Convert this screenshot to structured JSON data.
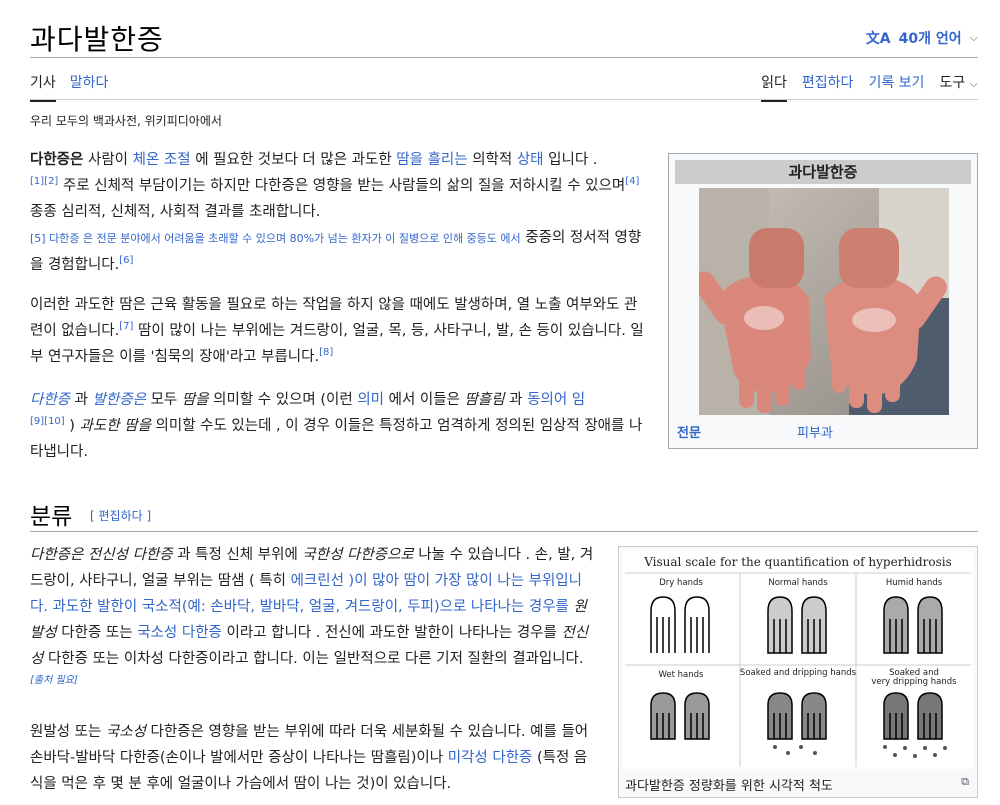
{
  "page": {
    "title": "과다발한증",
    "languages": "40개 언어",
    "tagline": "우리 모두의 백과사전, 위키피디아에서"
  },
  "tabs_left": [
    "기사",
    "말하다"
  ],
  "tabs_right": [
    "읽다",
    "편집하다",
    "기록 보기",
    "도구"
  ],
  "infobox": {
    "title": "과다발한증",
    "row_label": "전문",
    "row_value": "피부과"
  },
  "section": {
    "heading": "분류",
    "edit": "[ 편집하다 ]"
  },
  "figure": {
    "chart_title": "Visual scale for the quantification of hyperhidrosis",
    "panels": [
      "Dry hands",
      "Normal hands",
      "Humid hands",
      "Wet hands",
      "Soaked and dripping hands",
      "Soaked and very dripping hands"
    ],
    "caption": "과다발한증 정량화를 위한 시각적 척도"
  },
  "text": {
    "p1_a": "다한증은",
    "p1_b": " 사람이 ",
    "p1_link1": "체온 조절",
    "p1_c": " 에 필요한 것보다 더 많은 과도한 ",
    "p1_link2": "땀을 흘리는",
    "p1_d": " 의학적 ",
    "p1_link3": "상태",
    "p1_e": " 입니다 .",
    "p1_ref1": "[1][2]",
    "p1_f": " 주로 신체적 부담이기는 하지만 다한증은 영향을 받는 사람들의 삶의 질을 저하시킬 수 있으며",
    "p1_ref2": "[4]",
    "p1_g": " 종종 심리적, 신체적, 사회적 결과를 초래합니다.",
    "p1_small": "[5] 다한증 은 전문 분야에서 어려움을 초래할 수 있으며 80%가 넘는 환자가 이 질병으로 인해 중등도 에서",
    "p1_h": " 중증의 정서적 영향을 경험합니다.",
    "p1_ref3": "[6]",
    "p2_a": "이러한 과도한 땀은 근육 활동을 필요로 하는 작업을 하지 않을 때에도 발생하며, 열 노출 여부와도 관련이 없습니다.",
    "p2_ref1": "[7]",
    "p2_b": " 땀이 많이 나는 부위에는 겨드랑이, 얼굴, 목, 등, 사타구니, 발, 손 등이 있습니다. 일부 연구자들은 이를 '침묵의 장애'라고 부릅니다.",
    "p2_ref2": "[8]",
    "p3_link1": "다한증",
    "p3_a": " 과 ",
    "p3_link2": "발한증은",
    "p3_b": " 모두 ",
    "p3_c": "땀을",
    "p3_d": " 의미할 수 있으며 (이런 ",
    "p3_link3": "의미",
    "p3_e": " 에서 이들은 ",
    "p3_f": "땀흘림",
    "p3_g": " 과 ",
    "p3_link4": "동의어 임",
    "p3_ref": "[9][10]",
    "p3_h": " ) ",
    "p3_i": "과도한 땀을",
    "p3_j": " 의미할 수도 있는데 , 이 경우 이들은 특정하고 엄격하게 정의된 임상적 장애를 나타냅니다.",
    "p4_a": "다한증은 전신성 다한증",
    "p4_b": " 과 특정 신체 부위에 ",
    "p4_c": "국한성 다한증으로",
    "p4_d": " 나눌 수 있습니다 . 손, 발, 겨드랑이, 사타구니, 얼굴 부위는 땀샘 ( 특히 ",
    "p4_link1": "에크린선 )이 많아 땀이 가장 많이 나는 부위입니다. 과도한 발한이 국소적(예: 손바닥, 발바닥, 얼굴, 겨드랑이, 두피)으로 나타나는 경우를",
    "p4_e": " 원발성",
    "p4_f": " 다한증 또는 ",
    "p4_link2": "국소성 다한증",
    "p4_g": " 이라고 합니다 . 전신에 과도한 발한이 나타나는 경우를 ",
    "p4_h": "전신성",
    "p4_i": " 다한증 또는 이차성 다한증이라고 합니다. 이는 일반적으로 다른 기저 질환의 결과입니다.",
    "p4_ref": "[출처 필요]",
    "p5_a": "원발성 또는 ",
    "p5_b": "국소성",
    "p5_c": " 다한증은 영향을 받는 부위에 따라 더욱 세분화될 수 있습니다. 예를 들어 손바닥-발바닥 다한증(손이나 발에서만 증상이 나타나는 땀흘림)이나 ",
    "p5_link": "미각성 다한증",
    "p5_d": " (특정 음식을 먹은 후 몇 분 후에 얼굴이나 가슴에서 땀이 나는 것)이 있습니다."
  }
}
